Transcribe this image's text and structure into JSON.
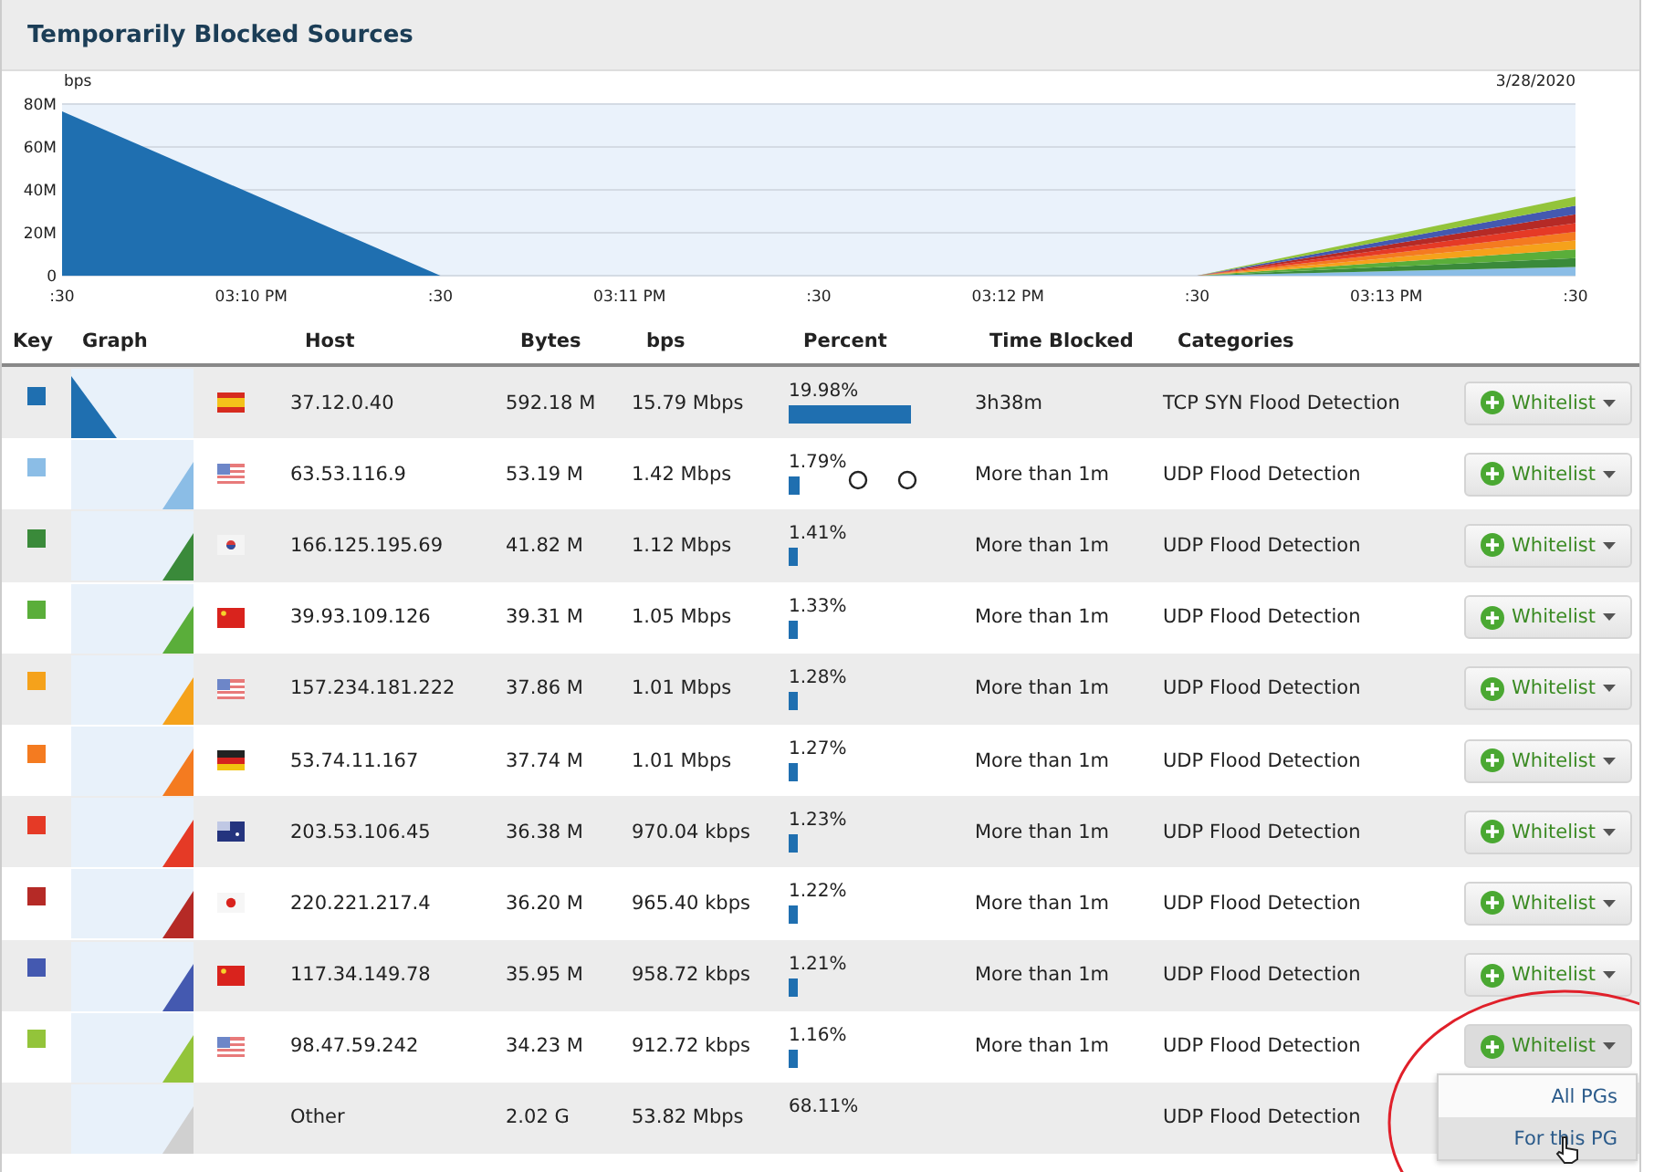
{
  "panel": {
    "title": "Temporarily Blocked Sources"
  },
  "chart": {
    "kind": "picture",
    "ylabel": "bps",
    "date": "3/28/2020",
    "yticks": [
      "80M",
      "60M",
      "40M",
      "20M",
      "0"
    ],
    "xticks": [
      ":30",
      "03:10 PM",
      ":30",
      "03:11 PM",
      ":30",
      "03:12 PM",
      ":30",
      "03:13 PM",
      ":30"
    ]
  },
  "table": {
    "columns": [
      "Key",
      "Graph",
      "Host",
      "Bytes",
      "bps",
      "Percent",
      "Time Blocked",
      "Categories"
    ],
    "rows": [
      {
        "color": "#1f6fb0",
        "graph": {
          "kind": "falling"
        },
        "flag": {
          "kind": "es"
        },
        "host": "37.12.0.40",
        "bytes": "592.18 M",
        "bps": "15.79 Mbps",
        "percent": "19.98%",
        "bar": true,
        "time": "3h38m",
        "category": "TCP SYN Flood Detection",
        "button": "Whitelist",
        "menu_open": false
      },
      {
        "color": "#8bbde6",
        "graph": {
          "kind": "rising"
        },
        "flag": {
          "kind": "us"
        },
        "host": "63.53.116.9",
        "bytes": "53.19 M",
        "bps": "1.42 Mbps",
        "percent": "1.79%",
        "bar": true,
        "circle_marks": true,
        "time": "More than 1m",
        "category": "UDP Flood Detection",
        "button": "Whitelist",
        "menu_open": false
      },
      {
        "color": "#3a8a3a",
        "graph": {
          "kind": "rising"
        },
        "flag": {
          "kind": "kr"
        },
        "host": "166.125.195.69",
        "bytes": "41.82 M",
        "bps": "1.12 Mbps",
        "percent": "1.41%",
        "bar": true,
        "time": "More than 1m",
        "category": "UDP Flood Detection",
        "button": "Whitelist",
        "menu_open": false
      },
      {
        "color": "#5aae3a",
        "graph": {
          "kind": "rising"
        },
        "flag": {
          "kind": "cn"
        },
        "host": "39.93.109.126",
        "bytes": "39.31 M",
        "bps": "1.05 Mbps",
        "percent": "1.33%",
        "bar": true,
        "time": "More than 1m",
        "category": "UDP Flood Detection",
        "button": "Whitelist",
        "menu_open": false
      },
      {
        "color": "#f5a21b",
        "graph": {
          "kind": "rising"
        },
        "flag": {
          "kind": "us"
        },
        "host": "157.234.181.222",
        "bytes": "37.86 M",
        "bps": "1.01 Mbps",
        "percent": "1.28%",
        "bar": true,
        "time": "More than 1m",
        "category": "UDP Flood Detection",
        "button": "Whitelist",
        "menu_open": false
      },
      {
        "color": "#f47b20",
        "graph": {
          "kind": "rising"
        },
        "flag": {
          "kind": "de"
        },
        "host": "53.74.11.167",
        "bytes": "37.74 M",
        "bps": "1.01 Mbps",
        "percent": "1.27%",
        "bar": true,
        "time": "More than 1m",
        "category": "UDP Flood Detection",
        "button": "Whitelist",
        "menu_open": false
      },
      {
        "color": "#e53a26",
        "graph": {
          "kind": "rising"
        },
        "flag": {
          "kind": "au"
        },
        "host": "203.53.106.45",
        "bytes": "36.38 M",
        "bps": "970.04 kbps",
        "percent": "1.23%",
        "bar": true,
        "time": "More than 1m",
        "category": "UDP Flood Detection",
        "button": "Whitelist",
        "menu_open": false
      },
      {
        "color": "#b52a26",
        "graph": {
          "kind": "rising"
        },
        "flag": {
          "kind": "jp"
        },
        "host": "220.221.217.4",
        "bytes": "36.20 M",
        "bps": "965.40 kbps",
        "percent": "1.22%",
        "bar": true,
        "time": "More than 1m",
        "category": "UDP Flood Detection",
        "button": "Whitelist",
        "menu_open": false
      },
      {
        "color": "#4459b0",
        "graph": {
          "kind": "rising"
        },
        "flag": {
          "kind": "cn"
        },
        "host": "117.34.149.78",
        "bytes": "35.95 M",
        "bps": "958.72 kbps",
        "percent": "1.21%",
        "bar": true,
        "time": "More than 1m",
        "category": "UDP Flood Detection",
        "button": "Whitelist",
        "menu_open": false
      },
      {
        "color": "#93c43a",
        "graph": {
          "kind": "rising"
        },
        "flag": {
          "kind": "us"
        },
        "host": "98.47.59.242",
        "bytes": "34.23 M",
        "bps": "912.72 kbps",
        "percent": "1.16%",
        "bar": true,
        "time": "More than 1m",
        "category": "UDP Flood Detection",
        "button": "Whitelist",
        "menu_open": true,
        "menu": [
          {
            "label": "All PGs",
            "selected": false
          },
          {
            "label": "For this PG",
            "selected": true
          }
        ]
      },
      {
        "graph": {
          "kind": "rising"
        },
        "host": "Other",
        "bytes": "2.02 G",
        "bps": "53.82 Mbps",
        "percent": "68.11%",
        "bar": false,
        "category": "UDP Flood Detection"
      }
    ]
  },
  "annotation": {
    "kind": "ellipse",
    "color": "#e0202a"
  }
}
